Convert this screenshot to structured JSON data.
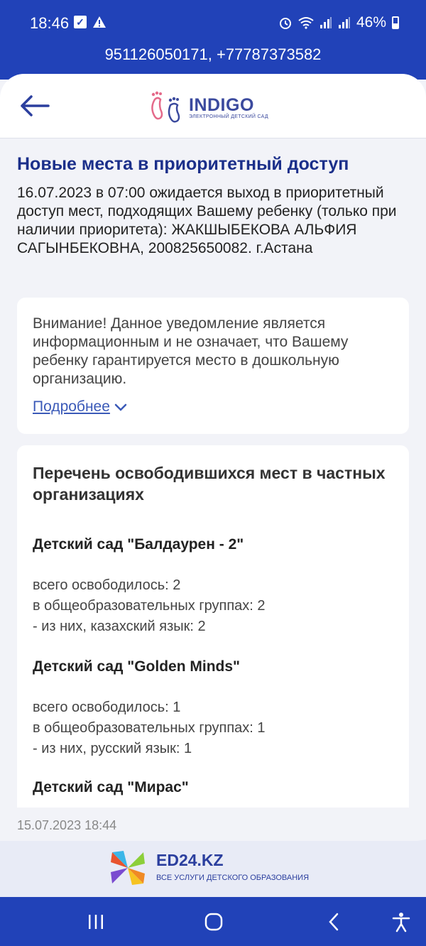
{
  "status": {
    "time": "18:46",
    "battery": "46%"
  },
  "phones": "951126050171, +77787373582",
  "header": {
    "logo_title": "INDIGO",
    "logo_subtitle": "ЭЛЕКТРОННЫЙ ДЕТСКИЙ САД"
  },
  "notice": {
    "title": "Новые места в приоритетный доступ",
    "text": "16.07.2023 в 07:00 ожидается выход в приоритетный доступ мест, подходящих Вашему ребенку (только при наличии приоритета): ЖАКШЫБЕКОВА АЛЬФИЯ САГЫНБЕКОВНА, 200825650082. г.Астана"
  },
  "warning": {
    "text": "Внимание! Данное уведомление является информационным и не означает, что Вашему ребенку гарантируется место в дошкольную организацию.",
    "more_label": "Подробнее"
  },
  "list": {
    "title": "Перечень освободившихся мест в частных организациях",
    "kindergartens": [
      {
        "name": "Детский сад \"Балдаурен - 2\"",
        "lines": [
          "всего освободилось: 2",
          "в общеобразовательных группах: 2",
          "- из них, казахский язык: 2"
        ]
      },
      {
        "name": "Детский сад \"Golden Minds\"",
        "lines": [
          "всего освободилось: 1",
          "в общеобразовательных группах: 1",
          "- из них, русский язык: 1"
        ]
      },
      {
        "name": "Детский сад \"Мирас\"",
        "lines": []
      }
    ]
  },
  "timestamp": "15.07.2023 18:44",
  "footer": {
    "brand": "ED24.KZ",
    "tagline": "ВСЕ УСЛУГИ ДЕТСКОГО ОБРАЗОВАНИЯ"
  },
  "icons": {
    "back": "arrow-left-icon",
    "chevron": "chevron-down-icon",
    "nav_recent": "recent-apps-icon",
    "nav_home": "home-icon",
    "nav_back": "back-icon",
    "nav_access": "accessibility-icon"
  },
  "colors": {
    "brand_blue": "#2142b8",
    "title_blue": "#1b2f8a",
    "link_blue": "#3b5ab8"
  }
}
